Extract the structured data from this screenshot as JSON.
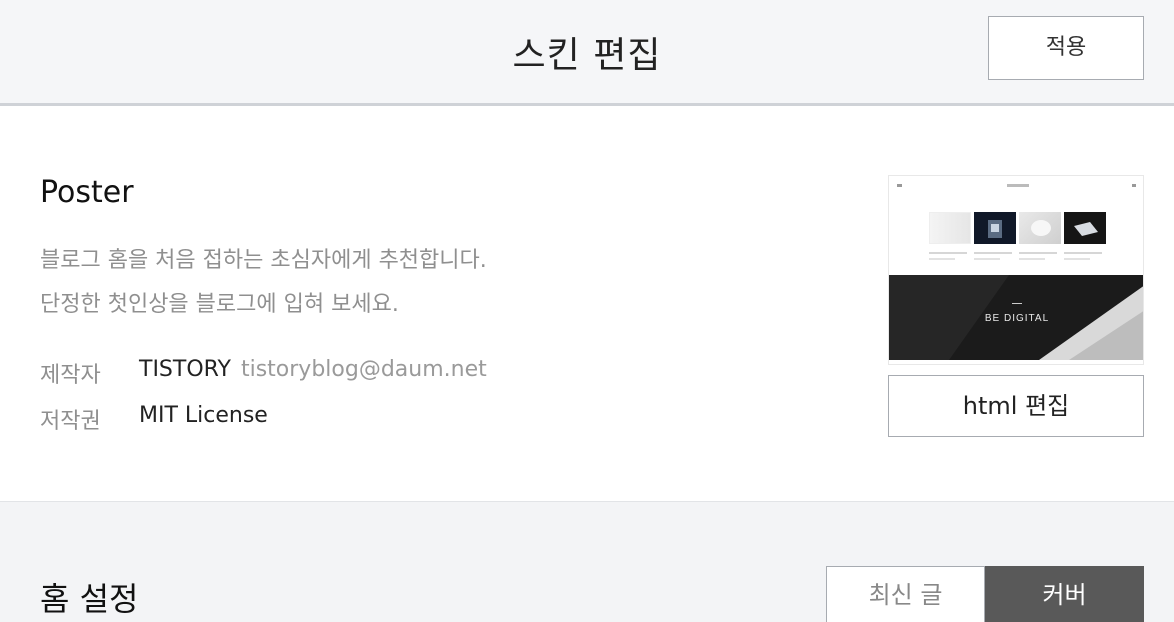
{
  "header": {
    "title": "스킨 편집",
    "apply_label": "적용"
  },
  "skin": {
    "name": "Poster",
    "description_line1": "블로그 홈을 처음 접하는 초심자에게 추천합니다.",
    "description_line2": "단정한 첫인상을 블로그에 입혀 보세요.",
    "maker_label": "제작자",
    "maker_name": "TISTORY",
    "maker_email": "tistoryblog@daum.net",
    "license_label": "저작권",
    "license_value": "MIT License",
    "preview_banner_text": "BE DIGITAL",
    "html_edit_label": "html 편집"
  },
  "home_settings": {
    "title": "홈 설정",
    "options": [
      "최신 글",
      "커버"
    ],
    "selected": "커버"
  },
  "colors": {
    "header_bg": "#f5f6f8",
    "toggle_selected_bg": "#595959",
    "muted_text": "#8f8f8f"
  }
}
